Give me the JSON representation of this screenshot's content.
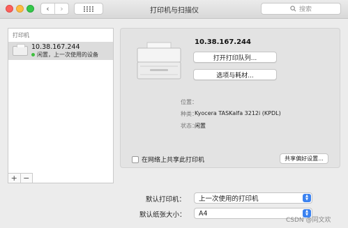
{
  "window": {
    "title": "打印机与扫描仪"
  },
  "toolbar": {
    "back_glyph": "‹",
    "forward_glyph": "›",
    "search_placeholder": "搜索"
  },
  "sidebar": {
    "header": "打印机",
    "printers": [
      {
        "name": "10.38.167.244",
        "status": "闲置，上一次使用的设备",
        "status_color": "#3fbf3f"
      }
    ],
    "add_label": "+",
    "remove_label": "−"
  },
  "detail": {
    "printer_name": "10.38.167.244",
    "open_queue_label": "打开打印队列...",
    "options_label": "选项与耗材...",
    "location_label": "位置：",
    "location_value": "",
    "kind_label": "种类：",
    "kind_value": "Kyocera TASKalfa 3212i (KPDL)",
    "status_label": "状态：",
    "status_value": "闲置",
    "share_label": "在网络上共享此打印机",
    "share_checked": false,
    "share_prefs_label": "共享偏好设置..."
  },
  "defaults": {
    "default_printer_label": "默认打印机：",
    "default_printer_value": "上一次使用的打印机",
    "paper_size_label": "默认纸张大小：",
    "paper_size_value": "A4"
  },
  "watermark": "CSDN @同文欢",
  "colors": {
    "accent": "#3b82f0",
    "close": "#fc605c",
    "minimize": "#fdbc40",
    "maximize": "#34c84a"
  }
}
